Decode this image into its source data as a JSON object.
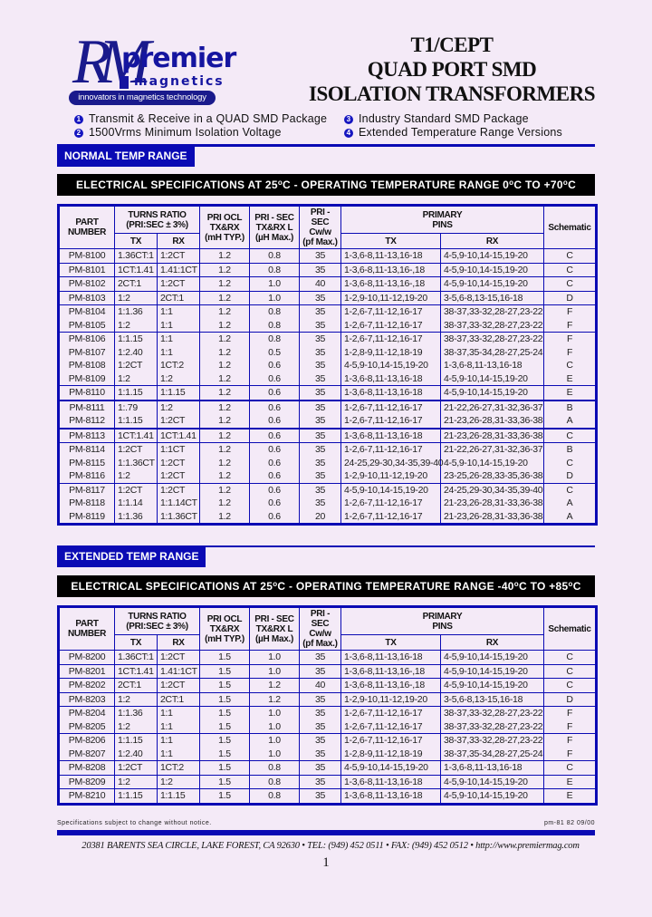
{
  "logo": {
    "monogram": "RM",
    "brand_top": "premier",
    "brand_bottom": "magnetics",
    "tagline": "innovators in magnetics technology"
  },
  "title": {
    "line1": "T1/CEPT",
    "line2": "QUAD PORT SMD",
    "line3": "ISOLATION TRANSFORMERS"
  },
  "features": [
    {
      "num": "1",
      "text": "Transmit & Receive in a QUAD SMD Package"
    },
    {
      "num": "2",
      "text": "1500Vrms Minimum Isolation Voltage"
    },
    {
      "num": "3",
      "text": "Industry Standard SMD Package"
    },
    {
      "num": "4",
      "text": "Extended Temperature Range Versions"
    }
  ],
  "headers": {
    "part_number": "PART NUMBER",
    "turns_ratio": "TURNS RATIO",
    "turns_ratio_sub": "(PRI:SEC ± 3%)",
    "tx": "TX",
    "rx": "RX",
    "pri_ocl": "PRI OCL",
    "pri_ocl_sub": "TX&RX",
    "pri_ocl_unit": "(mH TYP.)",
    "leakage": "PRI - SEC",
    "leakage_sub": "TX&RX L",
    "leakage_subscript": "L",
    "leakage_unit": "(µH Max.)",
    "cww": "PRI - SEC",
    "cww_sub": "Cw/w",
    "cww_unit": "(pf Max.)",
    "primary_pins": "PRIMARY",
    "primary_pins_sub": "PINS",
    "schematic": "Schematic"
  },
  "normal": {
    "section_label": "NORMAL TEMP RANGE",
    "spec_prefix": "ELECTRICAL SPECIFICATIONS AT 25",
    "spec_mid": "C - OPERATING TEMPERATURE RANGE 0",
    "spec_mid2": "C TO +70",
    "spec_end": "C",
    "rows": [
      {
        "part": "PM-8100",
        "tx": "1.36CT:1",
        "rx": "1:2CT",
        "ocl": "1.2",
        "ll": "0.8",
        "cww": "35",
        "ptx": "1-3,6-8,11-13,16-18",
        "prx": "4-5,9-10,14-15,19-20",
        "sch": "C"
      },
      {
        "part": "PM-8101",
        "tx": "1CT:1.41",
        "rx": "1.41:1CT",
        "ocl": "1.2",
        "ll": "0.8",
        "cww": "35",
        "ptx": "1-3,6-8,11-13,16-,18",
        "prx": "4-5,9-10,14-15,19-20",
        "sch": "C"
      },
      {
        "part": "PM-8102",
        "tx": "2CT:1",
        "rx": "1:2CT",
        "ocl": "1.2",
        "ll": "1.0",
        "cww": "40",
        "ptx": "1-3,6-8,11-13,16-,18",
        "prx": "4-5,9-10,14-15,19-20",
        "sch": "C"
      },
      {
        "part": "PM-8103",
        "tx": "1:2",
        "rx": "2CT:1",
        "ocl": "1.2",
        "ll": "1.0",
        "cww": "35",
        "ptx": "1-2,9-10,11-12,19-20",
        "prx": "3-5,6-8,13-15,16-18",
        "sch": "D"
      },
      {
        "part": "PM-8104",
        "tx": "1:1.36",
        "rx": "1:1",
        "ocl": "1.2",
        "ll": "0.8",
        "cww": "35",
        "ptx": "1-2,6-7,11-12,16-17",
        "prx": "38-37,33-32,28-27,23-22",
        "sch": "F"
      },
      {
        "part": "PM-8105",
        "tx": "1:2",
        "rx": "1:1",
        "ocl": "1.2",
        "ll": "0.8",
        "cww": "35",
        "ptx": "1-2,6-7,11-12,16-17",
        "prx": "38-37,33-32,28-27,23-22",
        "sch": "F"
      },
      {
        "part": "PM-8106",
        "tx": "1:1.15",
        "rx": "1:1",
        "ocl": "1.2",
        "ll": "0.8",
        "cww": "35",
        "ptx": "1-2,6-7,11-12,16-17",
        "prx": "38-37,33-32,28-27,23-22",
        "sch": "F"
      },
      {
        "part": "PM-8107",
        "tx": "1:2.40",
        "rx": "1:1",
        "ocl": "1.2",
        "ll": "0.5",
        "cww": "35",
        "ptx": "1-2,8-9,11-12,18-19",
        "prx": "38-37,35-34,28-27,25-24",
        "sch": "F"
      },
      {
        "part": "PM-8108",
        "tx": "1:2CT",
        "rx": "1CT:2",
        "ocl": "1.2",
        "ll": "0.6",
        "cww": "35",
        "ptx": "4-5,9-10,14-15,19-20",
        "prx": "1-3,6-8,11-13,16-18",
        "sch": "C"
      },
      {
        "part": "PM-8109",
        "tx": "1:2",
        "rx": "1:2",
        "ocl": "1.2",
        "ll": "0.6",
        "cww": "35",
        "ptx": "1-3,6-8,11-13,16-18",
        "prx": "4-5,9-10,14-15,19-20",
        "sch": "E"
      },
      {
        "part": "PM-8110",
        "tx": "1:1.15",
        "rx": "1:1.15",
        "ocl": "1.2",
        "ll": "0.6",
        "cww": "35",
        "ptx": "1-3,6-8,11-13,16-18",
        "prx": "4-5,9-10,14-15,19-20",
        "sch": "E"
      },
      {
        "part": "PM-8111",
        "tx": "1:.79",
        "rx": "1:2",
        "ocl": "1.2",
        "ll": "0.6",
        "cww": "35",
        "ptx": "1-2,6-7,11-12,16-17",
        "prx": "21-22,26-27,31-32,36-37",
        "sch": "B"
      },
      {
        "part": "PM-8112",
        "tx": "1:1.15",
        "rx": "1:2CT",
        "ocl": "1.2",
        "ll": "0.6",
        "cww": "35",
        "ptx": "1-2,6-7,11-12,16-17",
        "prx": "21-23,26-28,31-33,36-38",
        "sch": "A"
      },
      {
        "part": "PM-8113",
        "tx": "1CT:1.41",
        "rx": "1CT:1.41",
        "ocl": "1.2",
        "ll": "0.6",
        "cww": "35",
        "ptx": "1-3,6-8,11-13,16-18",
        "prx": "21-23,26-28,31-33,36-38",
        "sch": "C"
      },
      {
        "part": "PM-8114",
        "tx": "1:2CT",
        "rx": "1:1CT",
        "ocl": "1.2",
        "ll": "0.6",
        "cww": "35",
        "ptx": "1-2,6-7,11-12,16-17",
        "prx": "21-22,26-27,31-32,36-37",
        "sch": "B"
      },
      {
        "part": "PM-8115",
        "tx": "1:1.36CT",
        "rx": "1:2CT",
        "ocl": "1.2",
        "ll": "0.6",
        "cww": "35",
        "ptx": "24-25,29-30,34-35,39-40",
        "prx": "4-5,9-10,14-15,19-20",
        "sch": "C"
      },
      {
        "part": "PM-8116",
        "tx": "1:2",
        "rx": "1:2CT",
        "ocl": "1.2",
        "ll": "0.6",
        "cww": "35",
        "ptx": "1-2,9-10,11-12,19-20",
        "prx": "23-25,26-28,33-35,36-38",
        "sch": "D"
      },
      {
        "part": "PM-8117",
        "tx": "1:2CT",
        "rx": "1:2CT",
        "ocl": "1.2",
        "ll": "0.6",
        "cww": "35",
        "ptx": "4-5,9-10,14-15,19-20",
        "prx": "24-25,29-30,34-35,39-40",
        "sch": "C"
      },
      {
        "part": "PM-8118",
        "tx": "1:1.14",
        "rx": "1:1.14CT",
        "ocl": "1.2",
        "ll": "0.6",
        "cww": "35",
        "ptx": "1-2,6-7,11-12,16-17",
        "prx": "21-23,26-28,31-33,36-38",
        "sch": "A"
      },
      {
        "part": "PM-8119",
        "tx": "1:1.36",
        "rx": "1:1.36CT",
        "ocl": "1.2",
        "ll": "0.6",
        "cww": "20",
        "ptx": "1-2,6-7,11-12,16-17",
        "prx": "21-23,26-28,31-33,36-38",
        "sch": "A"
      }
    ]
  },
  "extended": {
    "section_label": "EXTENDED TEMP RANGE",
    "spec_prefix": "ELECTRICAL SPECIFICATIONS AT 25",
    "spec_mid": "C - OPERATING TEMPERATURE RANGE -40",
    "spec_mid2": "C TO +85",
    "spec_end": "C",
    "rows": [
      {
        "part": "PM-8200",
        "tx": "1.36CT:1",
        "rx": "1:2CT",
        "ocl": "1.5",
        "ll": "1.0",
        "cww": "35",
        "ptx": "1-3,6-8,11-13,16-18",
        "prx": "4-5,9-10,14-15,19-20",
        "sch": "C"
      },
      {
        "part": "PM-8201",
        "tx": "1CT:1.41",
        "rx": "1.41:1CT",
        "ocl": "1.5",
        "ll": "1.0",
        "cww": "35",
        "ptx": "1-3,6-8,11-13,16-,18",
        "prx": "4-5,9-10,14-15,19-20",
        "sch": "C"
      },
      {
        "part": "PM-8202",
        "tx": "2CT:1",
        "rx": "1:2CT",
        "ocl": "1.5",
        "ll": "1.2",
        "cww": "40",
        "ptx": "1-3,6-8,11-13,16-,18",
        "prx": "4-5,9-10,14-15,19-20",
        "sch": "C"
      },
      {
        "part": "PM-8203",
        "tx": "1:2",
        "rx": "2CT:1",
        "ocl": "1.5",
        "ll": "1.2",
        "cww": "35",
        "ptx": "1-2,9-10,11-12,19-20",
        "prx": "3-5,6-8,13-15,16-18",
        "sch": "D"
      },
      {
        "part": "PM-8204",
        "tx": "1:1.36",
        "rx": "1:1",
        "ocl": "1.5",
        "ll": "1.0",
        "cww": "35",
        "ptx": "1-2,6-7,11-12,16-17",
        "prx": "38-37,33-32,28-27,23-22",
        "sch": "F"
      },
      {
        "part": "PM-8205",
        "tx": "1:2",
        "rx": "1:1",
        "ocl": "1.5",
        "ll": "1.0",
        "cww": "35",
        "ptx": "1-2,6-7,11-12,16-17",
        "prx": "38-37,33-32,28-27,23-22",
        "sch": "F"
      },
      {
        "part": "PM-8206",
        "tx": "1:1.15",
        "rx": "1:1",
        "ocl": "1.5",
        "ll": "1.0",
        "cww": "35",
        "ptx": "1-2,6-7,11-12,16-17",
        "prx": "38-37,33-32,28-27,23-22",
        "sch": "F"
      },
      {
        "part": "PM-8207",
        "tx": "1:2.40",
        "rx": "1:1",
        "ocl": "1.5",
        "ll": "1.0",
        "cww": "35",
        "ptx": "1-2,8-9,11-12,18-19",
        "prx": "38-37,35-34,28-27,25-24",
        "sch": "F"
      },
      {
        "part": "PM-8208",
        "tx": "1:2CT",
        "rx": "1CT:2",
        "ocl": "1.5",
        "ll": "0.8",
        "cww": "35",
        "ptx": "4-5,9-10,14-15,19-20",
        "prx": "1-3,6-8,11-13,16-18",
        "sch": "C"
      },
      {
        "part": "PM-8209",
        "tx": "1:2",
        "rx": "1:2",
        "ocl": "1.5",
        "ll": "0.8",
        "cww": "35",
        "ptx": "1-3,6-8,11-13,16-18",
        "prx": "4-5,9-10,14-15,19-20",
        "sch": "E"
      },
      {
        "part": "PM-8210",
        "tx": "1:1.15",
        "rx": "1:1.15",
        "ocl": "1.5",
        "ll": "0.8",
        "cww": "35",
        "ptx": "1-3,6-8,11-13,16-18",
        "prx": "4-5,9-10,14-15,19-20",
        "sch": "E"
      }
    ]
  },
  "footer": {
    "disclaimer": "Specifications subject to change without notice.",
    "doc_code": "pm-81 82 09/00",
    "address": "20381 BARENTS SEA CIRCLE, LAKE FOREST, CA 92630 • TEL: (949) 452 0511 • FAX: (949) 452 0512 • http://www.premiermag.com",
    "page_number": "1"
  },
  "colors": {
    "accent_blue": "#0a0ab4",
    "spec_bar": "#000000",
    "page_bg": "#f4eaf7"
  }
}
